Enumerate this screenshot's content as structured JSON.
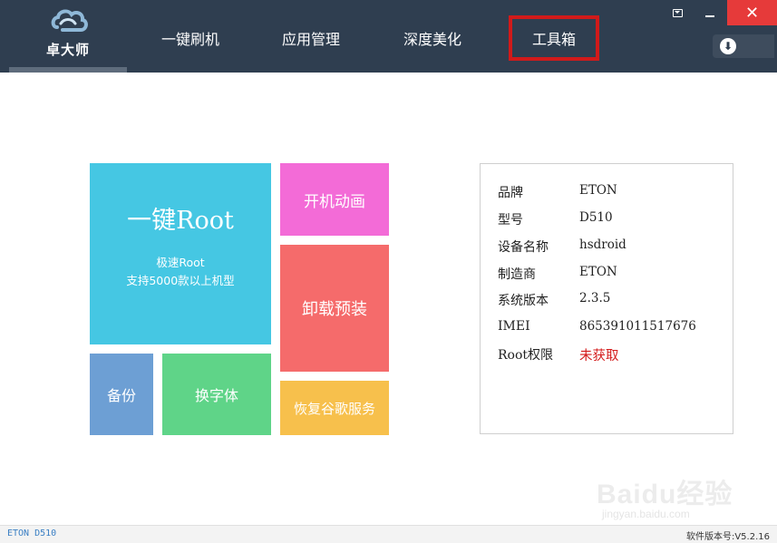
{
  "app": {
    "logo_text": "卓大师"
  },
  "nav": {
    "tabs": [
      {
        "label": "一键刷机"
      },
      {
        "label": "应用管理"
      },
      {
        "label": "深度美化"
      },
      {
        "label": "工具箱"
      }
    ]
  },
  "window_controls": {
    "close_glyph": "✕"
  },
  "download": {
    "icon_glyph": "⬇"
  },
  "tiles": {
    "root": {
      "title": "一键Root",
      "sub1": "极速Root",
      "sub2": "支持5000款以上机型",
      "color": "#45c7e3"
    },
    "boot_animation": {
      "label": "开机动画",
      "color": "#f36bd7"
    },
    "uninstall": {
      "label": "卸载预装",
      "color": "#f56b6b"
    },
    "backup": {
      "label": "备份",
      "color": "#6d9fd4"
    },
    "font": {
      "label": "换字体",
      "color": "#5fd488"
    },
    "google": {
      "label": "恢复谷歌服务",
      "color": "#f7c04c"
    }
  },
  "device_info": {
    "rows": [
      {
        "label": "品牌",
        "value": "ETON"
      },
      {
        "label": "型号",
        "value": "D510"
      },
      {
        "label": "设备名称",
        "value": "hsdroid"
      },
      {
        "label": "制造商",
        "value": "ETON"
      },
      {
        "label": "系统版本",
        "value": "2.3.5"
      },
      {
        "label": "IMEI",
        "value": "865391011517676"
      },
      {
        "label": "Root权限",
        "value": "未获取"
      }
    ]
  },
  "watermark": {
    "brand": "Baidu经验",
    "url": "jingyan.baidu.com"
  },
  "statusbar": {
    "device": "ETON D510",
    "version": "软件版本号:V5.2.16"
  },
  "colors": {
    "header_bg": "#2f3e50",
    "close_red": "#e63a3a",
    "highlight_red": "#d11a1a",
    "root_status_red": "#d41b1b"
  }
}
